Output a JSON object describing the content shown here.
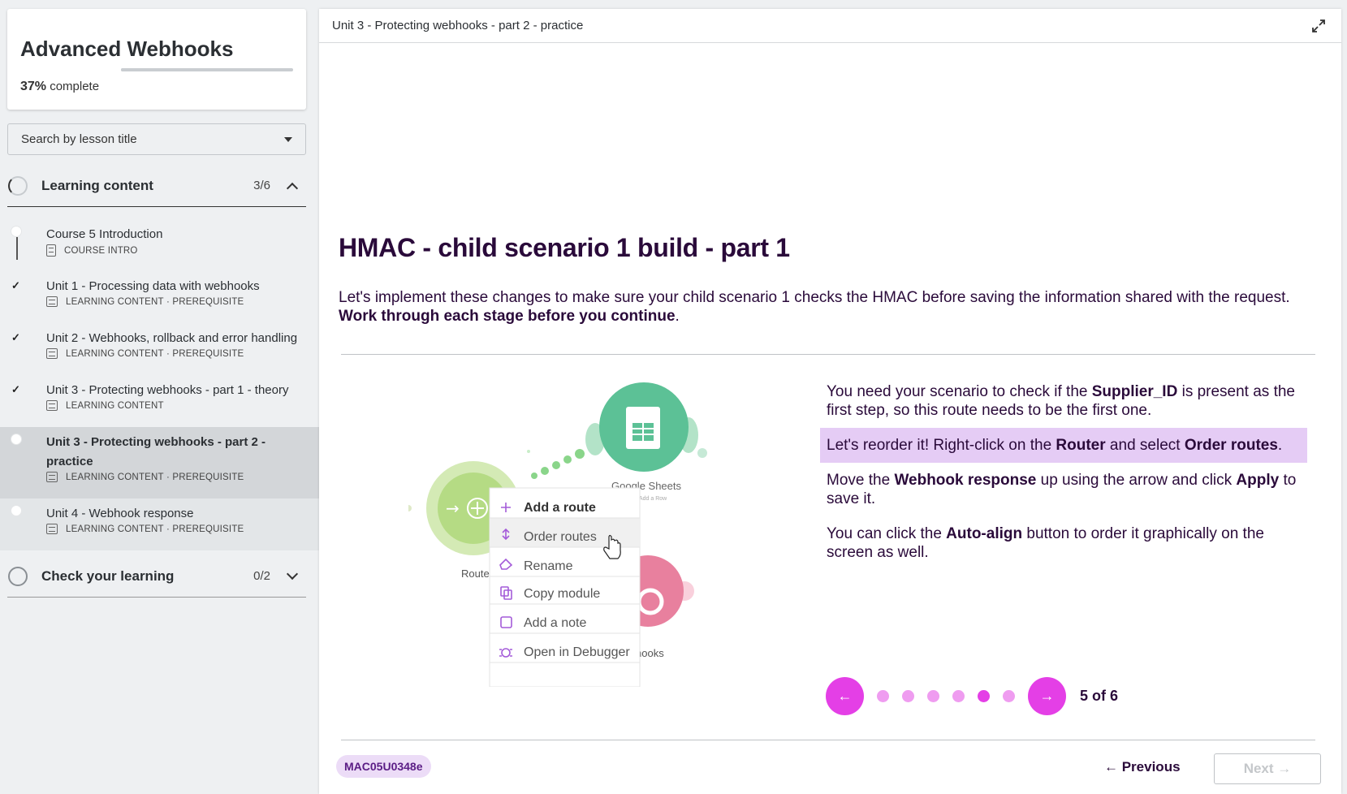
{
  "sidebar": {
    "course_title": "Advanced Webhooks",
    "progress_fraction": 0.37,
    "progress_percent": "37%",
    "progress_suffix": " complete",
    "search_placeholder": "Search by lesson title",
    "sections": [
      {
        "title": "Learning content",
        "count": "3/6",
        "expanded": true
      },
      {
        "title": "Check your learning",
        "count": "0/2",
        "expanded": false
      }
    ],
    "lessons": [
      {
        "title": "Course 5 Introduction",
        "meta": "COURSE INTRO",
        "status": "not-started"
      },
      {
        "title": "Unit 1 - Processing data with webhooks",
        "meta": "LEARNING CONTENT · PREREQUISITE",
        "status": "complete"
      },
      {
        "title": "Unit 2 - Webhooks, rollback and error handling",
        "meta": "LEARNING CONTENT · PREREQUISITE",
        "status": "complete"
      },
      {
        "title": "Unit 3 - Protecting webhooks - part 1 - theory",
        "meta": "LEARNING CONTENT",
        "status": "complete"
      },
      {
        "title": "Unit 3 - Protecting webhooks - part 2 - practice",
        "meta": "LEARNING CONTENT · PREREQUISITE",
        "status": "current"
      },
      {
        "title": "Unit 4 - Webhook response",
        "meta": "LEARNING CONTENT · PREREQUISITE",
        "status": "not-started"
      }
    ]
  },
  "main": {
    "topbar_title": "Unit 3 - Protecting webhooks - part 2 - practice",
    "heading": "HMAC - child scenario 1 build - part 1",
    "intro_text": "Let's implement these changes to make sure your child scenario 1 checks the HMAC before saving the information shared with the request. ",
    "intro_bold": "Work through each stage before you continue",
    "intro_end": ".",
    "illustration": {
      "google_sheets_label": "Google Sheets",
      "google_sheets_sub": "Add a Row",
      "router_label": "Route",
      "webhooks_label": "hooks",
      "menu_items": [
        "Add a route",
        "Order routes",
        "Rename",
        "Copy module",
        "Add a note",
        "Open in Debugger"
      ]
    },
    "steps": {
      "s1": [
        "You need your scenario to check if the ",
        "Supplier_ID",
        " is present as the first step, so this route needs to be the first one."
      ],
      "s2": [
        "Let's reorder it! Right-click on the ",
        "Router",
        " and select ",
        "Order routes",
        "."
      ],
      "s3": [
        "Move the ",
        "Webhook response",
        " up using the arrow and click ",
        "Apply",
        " to save it."
      ],
      "s4": [
        "You can click the ",
        "Auto-align",
        " button to order it graphically on the screen as well."
      ]
    },
    "carousel": {
      "current": 5,
      "total": 6,
      "counter_text": "5 of 6",
      "prev_arrow": "←",
      "next_arrow": "→"
    },
    "footer": {
      "code": "MAC05U0348e",
      "previous_label": "← Previous",
      "next_label": "Next →"
    }
  },
  "colors": {
    "accent": "#e43fe6",
    "accent_light": "#ef9cf0",
    "highlight": "#e5ccf5",
    "heading": "#2a0a3a"
  }
}
